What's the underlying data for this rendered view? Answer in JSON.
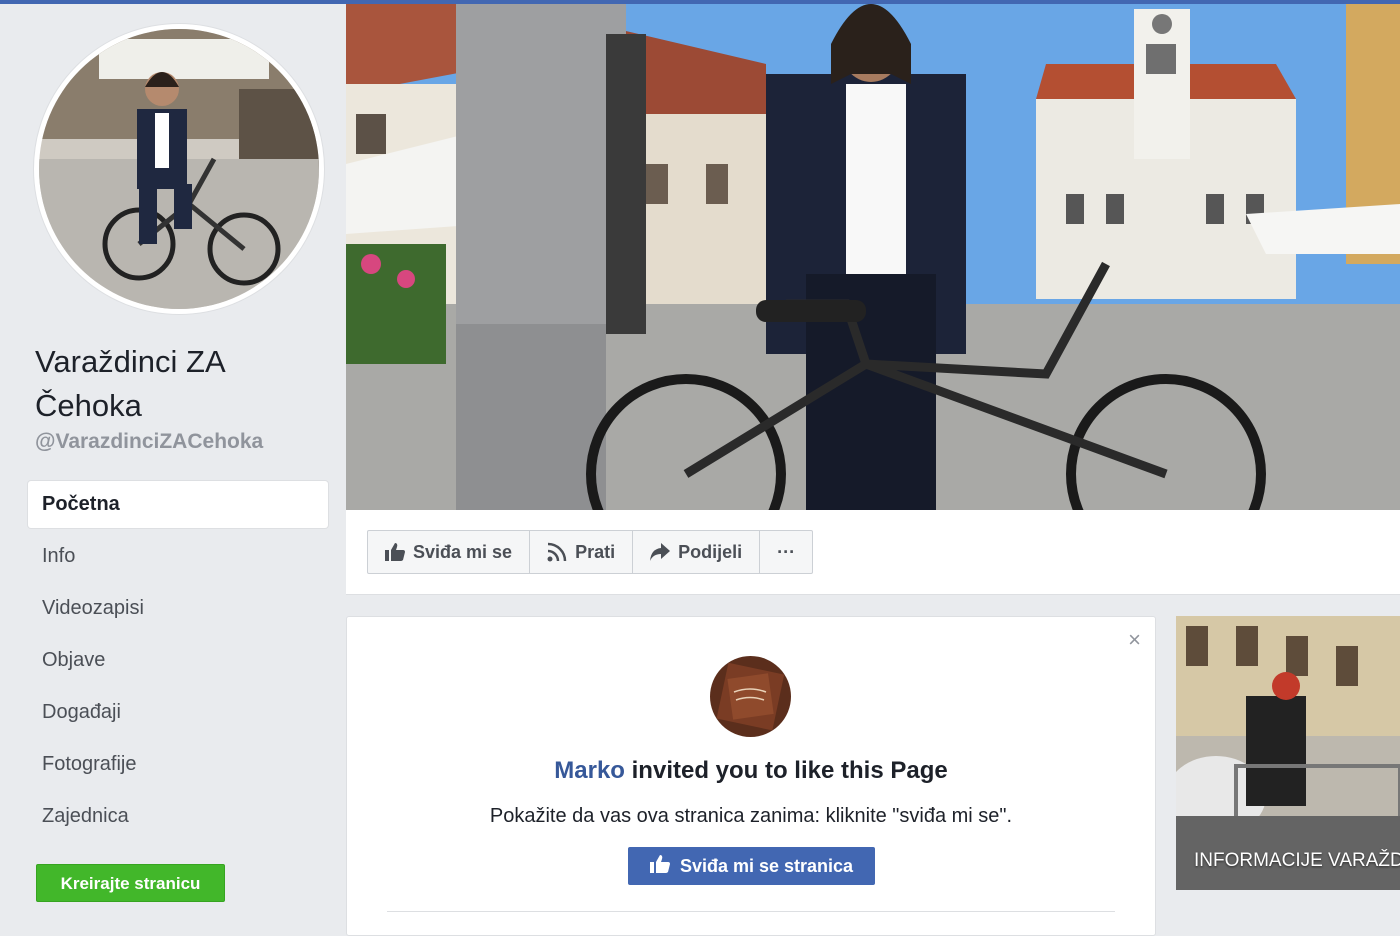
{
  "page": {
    "title": "Varaždinci ZA Čehoka",
    "handle": "@VarazdinciZACehoka"
  },
  "nav": {
    "items": [
      "Početna",
      "Info",
      "Videozapisi",
      "Objave",
      "Događaji",
      "Fotografije",
      "Zajednica"
    ],
    "active": "Početna"
  },
  "create_page_button": "Kreirajte stranicu",
  "actions": {
    "like": "Sviđa mi se",
    "follow": "Prati",
    "share": "Podijeli",
    "more": "···"
  },
  "invite": {
    "inviter": "Marko",
    "text": "invited you to like this Page",
    "subtext": "Pokažite da vas ova stranica zanima: kliknite \"sviđa mi se\".",
    "button": "Sviđa mi se stranica",
    "close": "×"
  },
  "right_card": {
    "label": "INFORMACIJE VARAŽD"
  },
  "colors": {
    "brand_blue": "#4267b2",
    "link_blue": "#365899",
    "green": "#42b72a",
    "background": "#e9ebee"
  },
  "icons": [
    "thumbs-up-icon",
    "rss-icon",
    "share-arrow-icon",
    "more-dots-icon",
    "close-icon"
  ]
}
